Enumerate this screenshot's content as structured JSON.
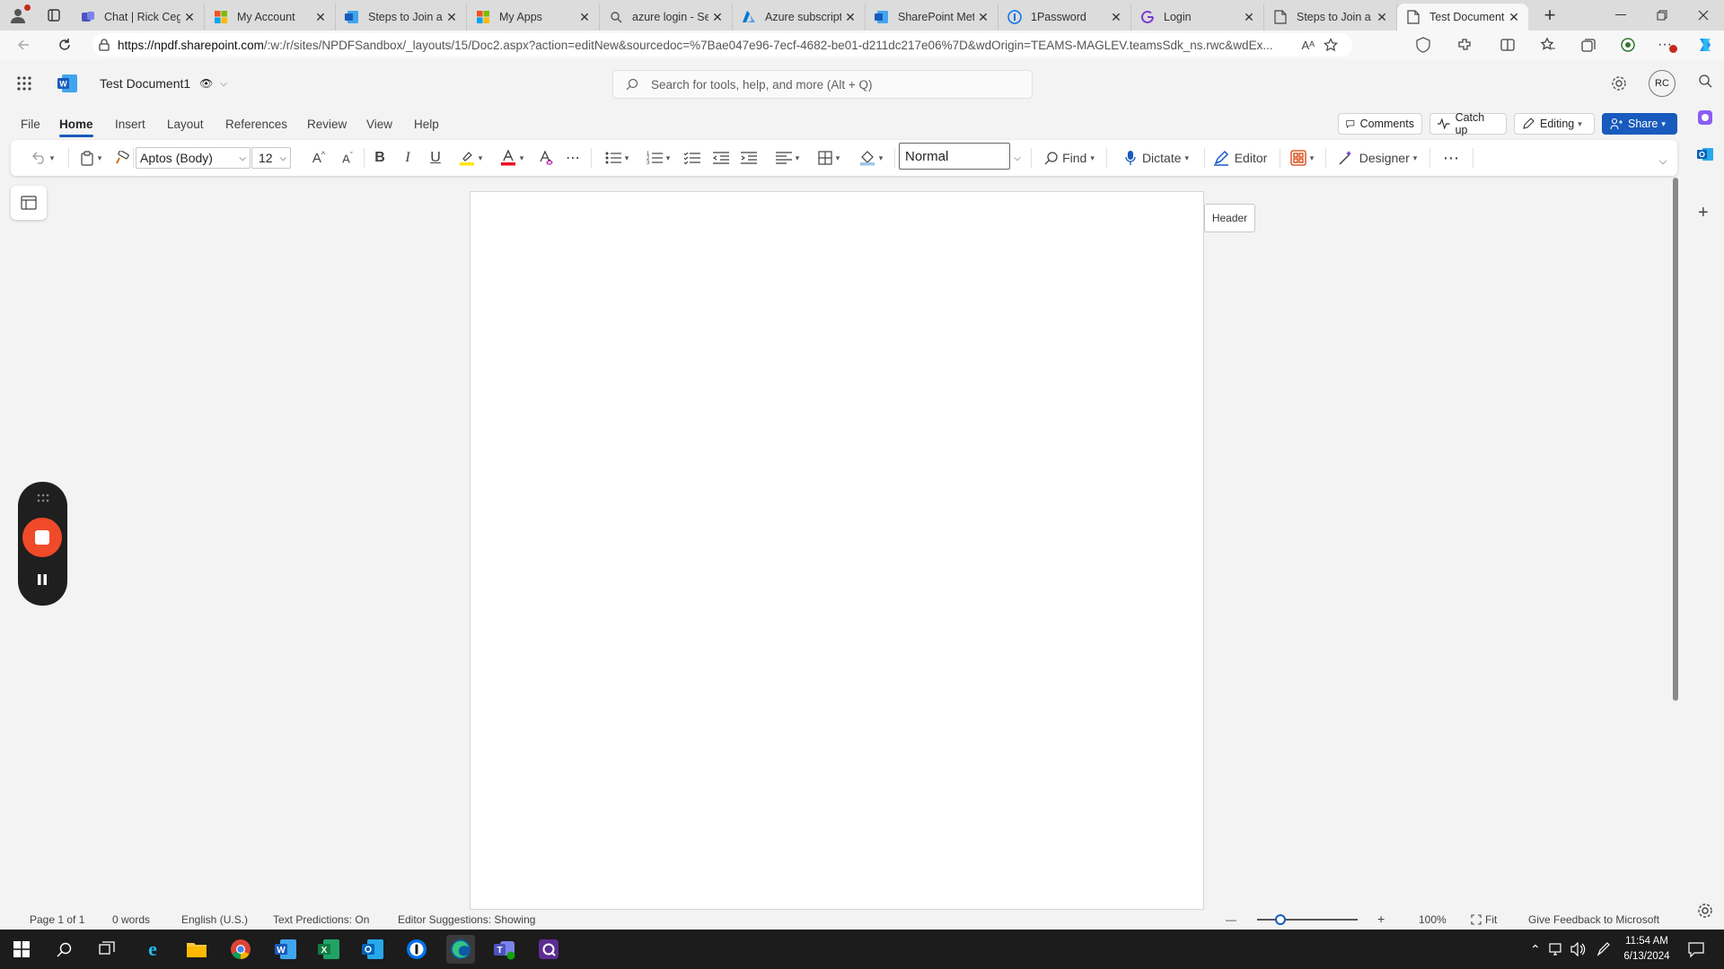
{
  "browser": {
    "tabs": [
      {
        "title": "Chat | Rick Ceg",
        "icon": "teams-icon",
        "active": false
      },
      {
        "title": "My Account",
        "icon": "microsoft-icon",
        "active": false
      },
      {
        "title": "Steps to Join a",
        "icon": "word-icon",
        "active": false
      },
      {
        "title": "My Apps",
        "icon": "microsoft-icon",
        "active": false
      },
      {
        "title": "azure login - Se",
        "icon": "search-icon",
        "active": false
      },
      {
        "title": "Azure subscripti",
        "icon": "azure-icon",
        "active": false
      },
      {
        "title": "SharePoint Meta",
        "icon": "word-icon",
        "active": false
      },
      {
        "title": "1Password",
        "icon": "1password-icon",
        "active": false
      },
      {
        "title": "Login",
        "icon": "g-icon",
        "active": false
      },
      {
        "title": "Steps to Join a",
        "icon": "page-icon",
        "active": false
      },
      {
        "title": "Test Document",
        "icon": "page-icon",
        "active": true
      }
    ],
    "url_host": "https://npdf.sharepoint.com",
    "url_path": "/:w:/r/sites/NPDFSandbox/_layouts/15/Doc2.aspx?action=editNew&sourcedoc=%7Bae047e96-7ecf-4682-be01-d211dc217e06%7D&wdOrigin=TEAMS-MAGLEV.teamsSdk_ns.rwc&wdEx..."
  },
  "word": {
    "doc_title": "Test Document1",
    "search_placeholder": "Search for tools, help, and more (Alt + Q)",
    "avatar_initials": "RC",
    "menus": [
      "File",
      "Home",
      "Insert",
      "Layout",
      "References",
      "Review",
      "View",
      "Help"
    ],
    "active_menu": "Home",
    "comments_label": "Comments",
    "catchup_label": "Catch up",
    "editing_label": "Editing",
    "share_label": "Share",
    "font_name": "Aptos (Body)",
    "font_size": "12",
    "style_name": "Normal",
    "find_label": "Find",
    "dictate_label": "Dictate",
    "editor_label": "Editor",
    "designer_label": "Designer",
    "header_tooltip": "Header",
    "brand_color": "#185abd"
  },
  "statusbar": {
    "page": "Page 1 of 1",
    "words": "0 words",
    "language": "English (U.S.)",
    "predictions": "Text Predictions: On",
    "suggestions": "Editor Suggestions: Showing",
    "zoom_minus": "—",
    "zoom_plus": "+",
    "zoom": "100%",
    "fit": "Fit",
    "feedback": "Give Feedback to Microsoft"
  },
  "taskbar": {
    "time": "11:54 AM",
    "date": "6/13/2024"
  }
}
